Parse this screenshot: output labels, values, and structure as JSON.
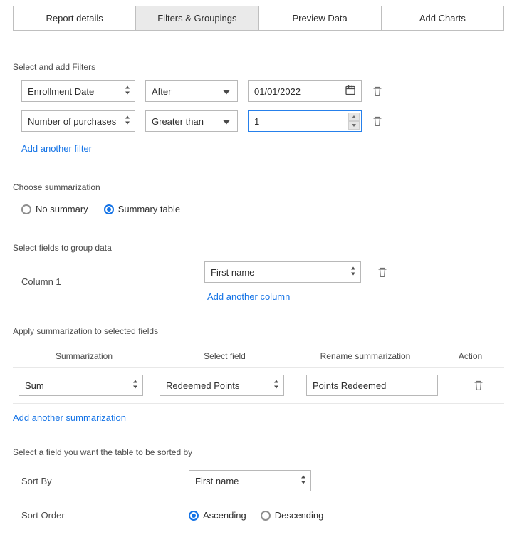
{
  "tabs": [
    {
      "label": "Report details"
    },
    {
      "label": "Filters & Groupings"
    },
    {
      "label": "Preview Data"
    },
    {
      "label": "Add Charts"
    }
  ],
  "active_tab": 1,
  "filters": {
    "heading": "Select and add Filters",
    "rows": [
      {
        "field": "Enrollment Date",
        "operator": "After",
        "value": "01/01/2022",
        "value_type": "date"
      },
      {
        "field": "Number of purchases",
        "operator": "Greater than",
        "value": "1",
        "value_type": "number",
        "focused": true
      }
    ],
    "add_label": "Add another filter"
  },
  "summarization_choice": {
    "heading": "Choose summarization",
    "options": [
      {
        "label": "No summary",
        "checked": false
      },
      {
        "label": "Summary table",
        "checked": true
      }
    ]
  },
  "grouping": {
    "heading": "Select fields to group data",
    "column_label": "Column 1",
    "column_field": "First name",
    "add_label": "Add another column"
  },
  "apply_summary": {
    "heading": "Apply summarization to selected fields",
    "headers": {
      "summarization": "Summarization",
      "select_field": "Select field",
      "rename": "Rename summarization",
      "action": "Action"
    },
    "rows": [
      {
        "summarization": "Sum",
        "field": "Redeemed Points",
        "rename": "Points Redeemed"
      }
    ],
    "add_label": "Add another summarization"
  },
  "sorting": {
    "heading": "Select a field you want the table to be sorted by",
    "sort_by_label": "Sort By",
    "sort_by_field": "First name",
    "sort_order_label": "Sort Order",
    "options": [
      {
        "label": "Ascending",
        "checked": true
      },
      {
        "label": "Descending",
        "checked": false
      }
    ]
  }
}
